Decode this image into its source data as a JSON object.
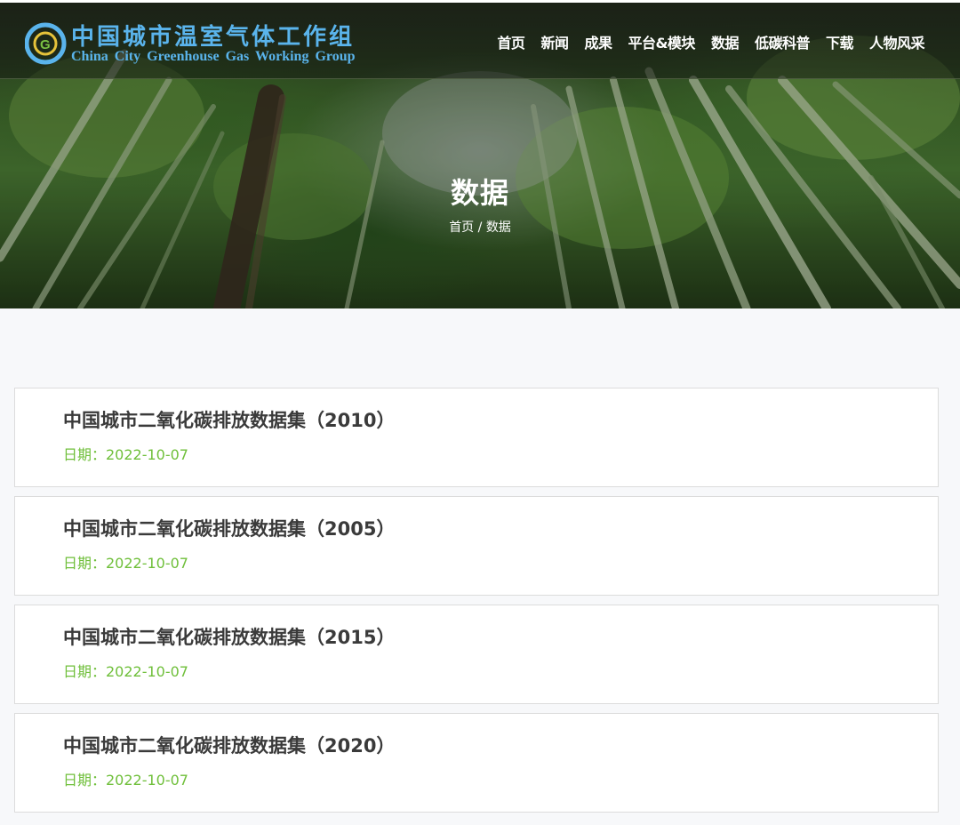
{
  "header": {
    "logo_cn": "中国城市温室气体工作组",
    "logo_en": "China City Greenhouse Gas Working Group",
    "nav": [
      {
        "label": "首页"
      },
      {
        "label": "新闻"
      },
      {
        "label": "成果"
      },
      {
        "label": "平台&模块"
      },
      {
        "label": "数据"
      },
      {
        "label": "低碳科普"
      },
      {
        "label": "下载"
      },
      {
        "label": "人物风采"
      }
    ]
  },
  "hero": {
    "title": "数据",
    "breadcrumb": {
      "home": "首页",
      "separator": "/",
      "current": "数据"
    }
  },
  "list": {
    "items": [
      {
        "title": "中国城市二氧化碳排放数据集（2010）",
        "date": "日期：2022-10-07"
      },
      {
        "title": "中国城市二氧化碳排放数据集（2005）",
        "date": "日期：2022-10-07"
      },
      {
        "title": "中国城市二氧化碳排放数据集（2015）",
        "date": "日期：2022-10-07"
      },
      {
        "title": "中国城市二氧化碳排放数据集（2020）",
        "date": "日期：2022-10-07"
      }
    ]
  },
  "colors": {
    "logo_blue": "#5ab4ec",
    "date_green": "#6fbf3a",
    "title_gray": "#3a3a3a",
    "page_bg": "#f7f8fa"
  }
}
